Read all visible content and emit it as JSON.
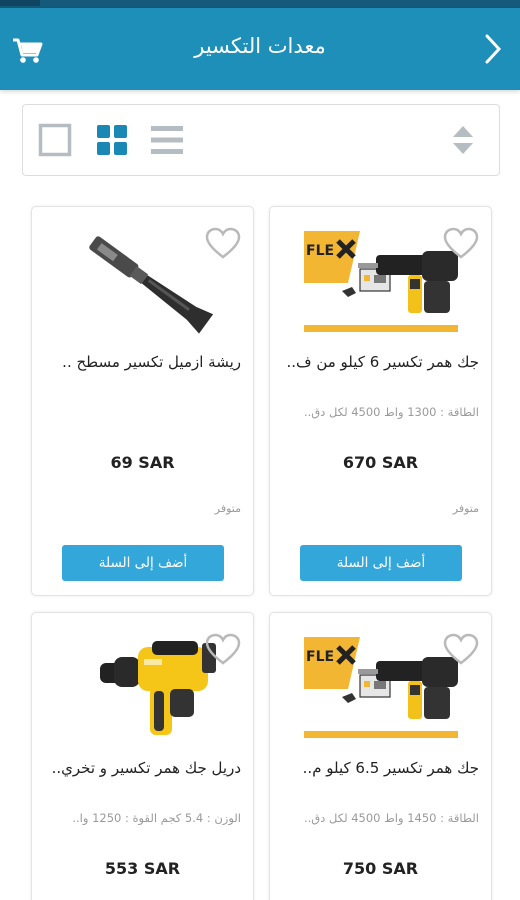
{
  "header": {
    "title": "معدات التكسير"
  },
  "toolbar": {
    "view_modes": [
      "list",
      "grid",
      "single"
    ],
    "active_view": "grid"
  },
  "colors": {
    "app_bar": "#1e8fb9",
    "accent": "#33a7da",
    "active_icon": "#1b87b5",
    "inactive_icon": "#b6bdc2"
  },
  "products": [
    {
      "name": "جك همر تكسير 6 كيلو من ف..",
      "spec": "الطاقة : 1300 واط   4500 لكل دق..",
      "price": "670 SAR",
      "stock": "متوفر",
      "add_label": "أضف إلى السلة",
      "image": "jackhammer-flex-kit"
    },
    {
      "name": "ريشة ازميل تكسير مسطح ..",
      "spec": "",
      "price": "69 SAR",
      "stock": "متوفر",
      "add_label": "أضف إلى السلة",
      "image": "flat-chisel"
    },
    {
      "name": "جك همر تكسير 6.5 كيلو م..",
      "spec": "الطاقة : 1450 واط   4500 لكل دق..",
      "price": "750 SAR",
      "stock": "",
      "add_label": "",
      "image": "jackhammer-flex-kit"
    },
    {
      "name": "دريل جك همر تكسير و تخري..",
      "spec": "الوزن : 5.4 كجم  القوة : 1250 وا..",
      "price": "553 SAR",
      "stock": "",
      "add_label": "",
      "image": "yellow-rotary-hammer"
    }
  ]
}
